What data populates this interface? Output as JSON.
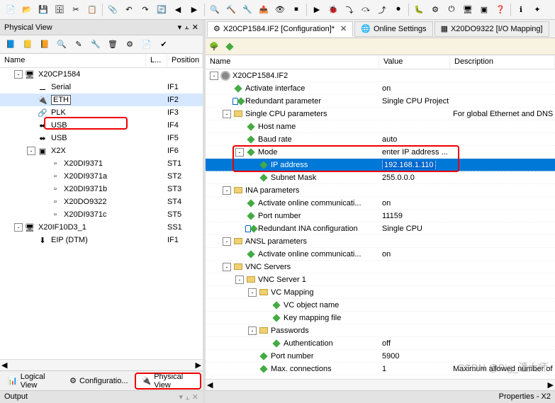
{
  "toolbar_icons": [
    "new-file",
    "open",
    "save",
    "save-all",
    "cut",
    "copy",
    "paste",
    "undo",
    "redo",
    "refresh",
    "nav-back",
    "nav-fwd",
    "find",
    "build",
    "rebuild",
    "transfer",
    "monitor",
    "stop",
    "run",
    "debug",
    "step-in",
    "step-over",
    "step-out",
    "break",
    "bug",
    "settings",
    "power",
    "cpu",
    "module",
    "help",
    "info",
    "ext"
  ],
  "left_pane": {
    "title": "Physical View",
    "headers": {
      "name": "Name",
      "l": "L...",
      "pos": "Position"
    },
    "tree": [
      {
        "indent": 0,
        "exp": "-",
        "icon": "cpu",
        "name": "X20CP1584",
        "pos": ""
      },
      {
        "indent": 1,
        "exp": "",
        "icon": "serial",
        "name": "Serial",
        "pos": "IF1"
      },
      {
        "indent": 1,
        "exp": "",
        "icon": "eth",
        "name": "ETH",
        "pos": "IF2",
        "selected": true
      },
      {
        "indent": 1,
        "exp": "",
        "icon": "plk",
        "name": "PLK",
        "pos": "IF3"
      },
      {
        "indent": 1,
        "exp": "",
        "icon": "usb",
        "name": "USB",
        "pos": "IF4"
      },
      {
        "indent": 1,
        "exp": "",
        "icon": "usb",
        "name": "USB",
        "pos": "IF5"
      },
      {
        "indent": 1,
        "exp": "-",
        "icon": "x2x",
        "name": "X2X",
        "pos": "IF6"
      },
      {
        "indent": 2,
        "exp": "",
        "icon": "mod",
        "name": "X20DI9371",
        "pos": "ST1"
      },
      {
        "indent": 2,
        "exp": "",
        "icon": "mod",
        "name": "X20DI9371a",
        "pos": "ST2"
      },
      {
        "indent": 2,
        "exp": "",
        "icon": "mod",
        "name": "X20DI9371b",
        "pos": "ST3"
      },
      {
        "indent": 2,
        "exp": "",
        "icon": "mod",
        "name": "X20DO9322",
        "pos": "ST4"
      },
      {
        "indent": 2,
        "exp": "",
        "icon": "mod",
        "name": "X20DI9371c",
        "pos": "ST5"
      },
      {
        "indent": 0,
        "exp": "-",
        "icon": "cpu",
        "name": "X20IF10D3_1",
        "pos": "SS1"
      },
      {
        "indent": 1,
        "exp": "",
        "icon": "eip",
        "name": "EIP (DTM)",
        "pos": "IF1"
      }
    ],
    "bottom_tabs": [
      {
        "icon": "logical",
        "label": "Logical View",
        "active": false
      },
      {
        "icon": "config",
        "label": "Configuratio...",
        "active": false
      },
      {
        "icon": "physical",
        "label": "Physical View",
        "active": true
      }
    ],
    "output_label": "Output"
  },
  "right_pane": {
    "tabs": [
      {
        "icon": "config",
        "label": "X20CP1584.IF2 [Configuration]*",
        "active": true,
        "closeable": true
      },
      {
        "icon": "online",
        "label": "Online Settings",
        "active": false
      },
      {
        "icon": "io",
        "label": "X20DO9322 [I/O Mapping]",
        "active": false
      }
    ],
    "headers": {
      "name": "Name",
      "value": "Value",
      "desc": "Description"
    },
    "rows": [
      {
        "indent": 0,
        "exp": "-",
        "icon": "root",
        "name": "X20CP1584.IF2",
        "val": "",
        "desc": ""
      },
      {
        "indent": 1,
        "exp": "",
        "icon": "green",
        "name": "Activate interface",
        "val": "on",
        "desc": ""
      },
      {
        "indent": 1,
        "exp": "",
        "icon": "lock-green",
        "name": "Redundant parameter",
        "val": "Single CPU Project",
        "desc": ""
      },
      {
        "indent": 1,
        "exp": "-",
        "icon": "folder",
        "name": "Single CPU parameters",
        "val": "",
        "desc": "For global Ethernet and DNS"
      },
      {
        "indent": 2,
        "exp": "",
        "icon": "green",
        "name": "Host name",
        "val": "",
        "desc": ""
      },
      {
        "indent": 2,
        "exp": "",
        "icon": "green",
        "name": "Baud rate",
        "val": "auto",
        "desc": ""
      },
      {
        "indent": 2,
        "exp": "-",
        "icon": "green",
        "name": "Mode",
        "val": "enter IP address ...",
        "desc": "",
        "redbox": true
      },
      {
        "indent": 3,
        "exp": "",
        "icon": "green",
        "name": "IP address",
        "val": "192.168.1.110",
        "desc": "",
        "selected": true
      },
      {
        "indent": 3,
        "exp": "",
        "icon": "green",
        "name": "Subnet Mask",
        "val": "255.0.0.0",
        "desc": ""
      },
      {
        "indent": 1,
        "exp": "-",
        "icon": "folder",
        "name": "INA parameters",
        "val": "",
        "desc": ""
      },
      {
        "indent": 2,
        "exp": "",
        "icon": "green",
        "name": "Activate online communicati...",
        "val": "on",
        "desc": ""
      },
      {
        "indent": 2,
        "exp": "",
        "icon": "green",
        "name": "Port number",
        "val": "11159",
        "desc": ""
      },
      {
        "indent": 2,
        "exp": "",
        "icon": "lock-green",
        "name": "Redundant INA configuration",
        "val": "Single CPU",
        "desc": ""
      },
      {
        "indent": 1,
        "exp": "-",
        "icon": "folder",
        "name": "ANSL parameters",
        "val": "",
        "desc": ""
      },
      {
        "indent": 2,
        "exp": "",
        "icon": "green",
        "name": "Activate online communicati...",
        "val": "on",
        "desc": ""
      },
      {
        "indent": 1,
        "exp": "-",
        "icon": "folder",
        "name": "VNC Servers",
        "val": "",
        "desc": ""
      },
      {
        "indent": 2,
        "exp": "-",
        "icon": "folder",
        "name": "VNC Server 1",
        "val": "",
        "desc": ""
      },
      {
        "indent": 3,
        "exp": "-",
        "icon": "folder",
        "name": "VC Mapping",
        "val": "",
        "desc": ""
      },
      {
        "indent": 4,
        "exp": "",
        "icon": "green",
        "name": "VC object name",
        "val": "",
        "desc": ""
      },
      {
        "indent": 4,
        "exp": "",
        "icon": "green",
        "name": "Key mapping file",
        "val": "",
        "desc": ""
      },
      {
        "indent": 3,
        "exp": "-",
        "icon": "folder",
        "name": "Passwords",
        "val": "",
        "desc": ""
      },
      {
        "indent": 4,
        "exp": "",
        "icon": "green",
        "name": "Authentication",
        "val": "off",
        "desc": ""
      },
      {
        "indent": 3,
        "exp": "",
        "icon": "green",
        "name": "Port number",
        "val": "5900",
        "desc": ""
      },
      {
        "indent": 3,
        "exp": "",
        "icon": "green",
        "name": "Max. connections",
        "val": "1",
        "desc": "Maximum allowed number of c"
      }
    ],
    "bottom_right": "Properties - X2"
  },
  "watermark": "CSDN @Big_潘大师"
}
